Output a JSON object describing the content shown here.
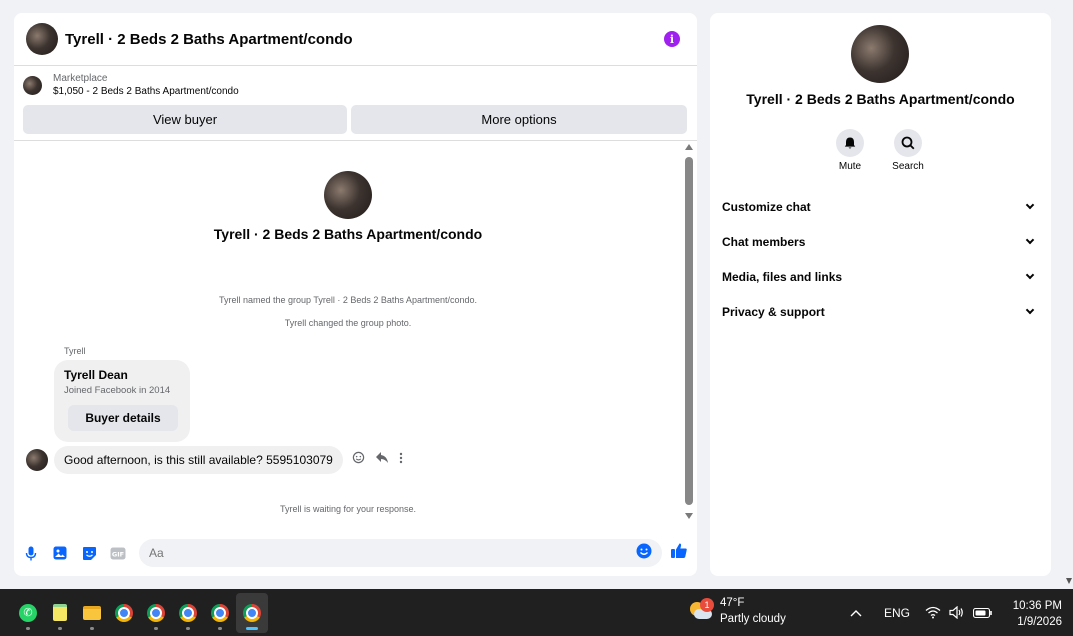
{
  "conversation": {
    "title": "Tyrell · 2 Beds 2 Baths Apartment/condo",
    "info_icon": "info-icon",
    "marketplace_label": "Marketplace",
    "listing": "$1,050 - 2 Beds 2 Baths Apartment/condo",
    "view_buyer": "View buyer",
    "more_options": "More options"
  },
  "thread": {
    "title": "Tyrell · 2 Beds 2 Baths Apartment/condo",
    "system_messages": [
      "Tyrell named the group Tyrell · 2 Beds 2 Baths Apartment/condo.",
      "Tyrell changed the group photo."
    ],
    "sender": "Tyrell",
    "buyer_card": {
      "name": "Tyrell Dean",
      "joined": "Joined Facebook in 2014",
      "button": "Buyer details"
    },
    "message": "Good afternoon, is this still available? 5595103079",
    "waiting": "Tyrell is waiting for your response."
  },
  "composer": {
    "placeholder": "Aa",
    "icons": [
      "microphone-icon",
      "image-icon",
      "sticker-icon",
      "gif-icon",
      "emoji-icon",
      "like-icon"
    ]
  },
  "details": {
    "title": "Tyrell · 2 Beds 2 Baths Apartment/condo",
    "mute": "Mute",
    "search": "Search",
    "sections": [
      "Customize chat",
      "Chat members",
      "Media, files and links",
      "Privacy & support"
    ]
  },
  "taskbar": {
    "weather_badge": "1",
    "temperature": "47°F",
    "condition": "Partly cloudy",
    "language": "ENG",
    "time": "10:36 PM",
    "date": "1/9/2026"
  },
  "colors": {
    "accent": "#0866ff",
    "info": "#a020f0",
    "taskbar": "#202020"
  }
}
